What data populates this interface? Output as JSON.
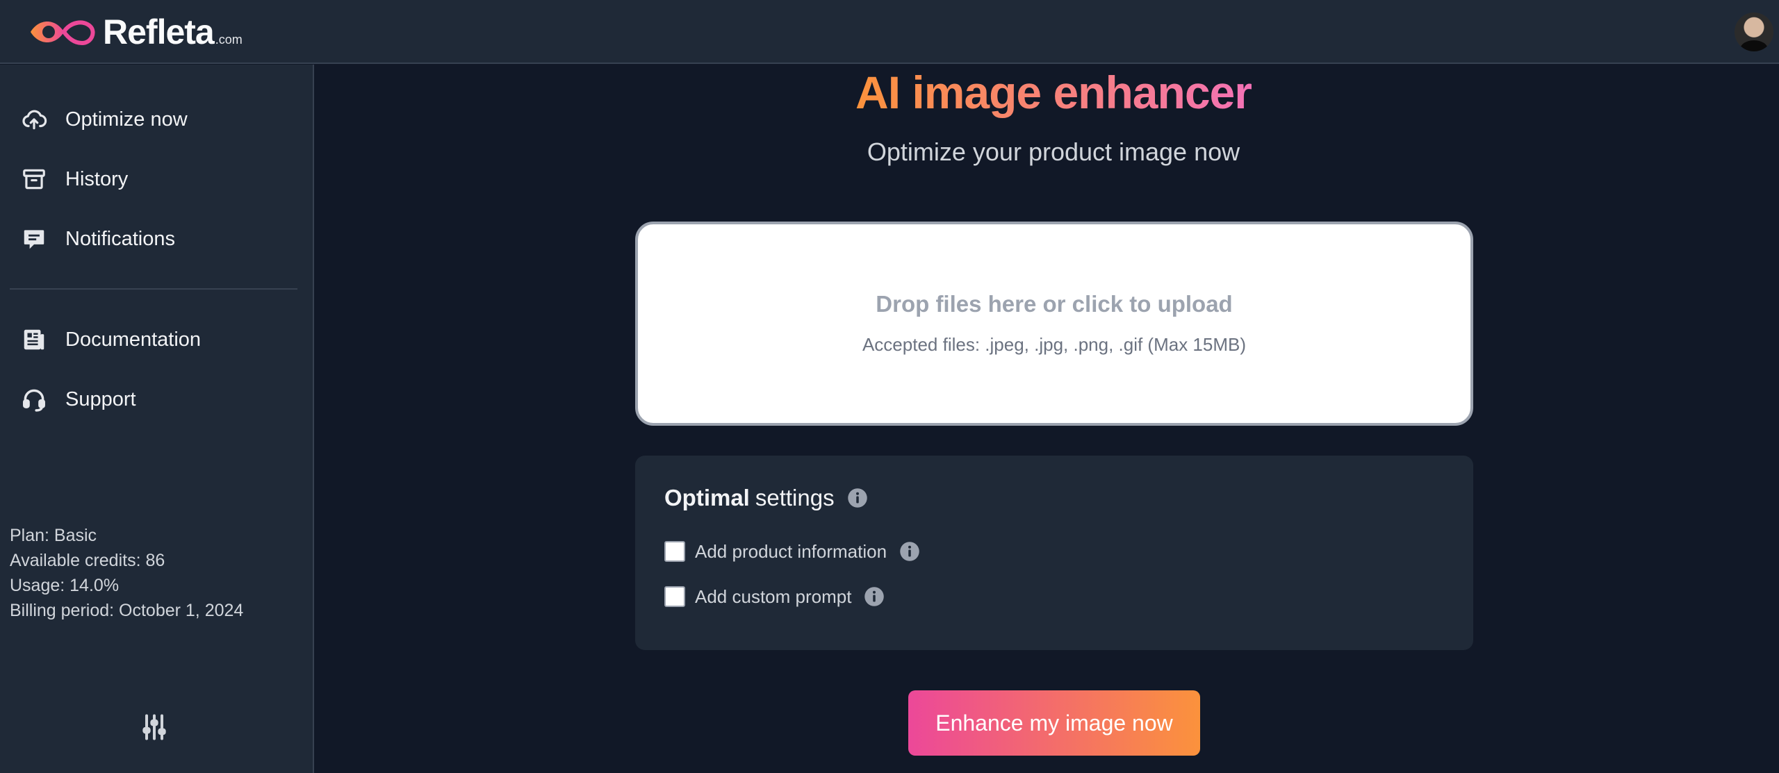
{
  "brand": {
    "name": "Refleta",
    "suffix": ".com"
  },
  "sidebar": {
    "items": [
      {
        "label": "Optimize now",
        "icon": "cloud-upload-icon"
      },
      {
        "label": "History",
        "icon": "archive-icon"
      },
      {
        "label": "Notifications",
        "icon": "message-icon"
      },
      {
        "label": "Documentation",
        "icon": "document-icon"
      },
      {
        "label": "Support",
        "icon": "headset-icon"
      }
    ],
    "plan": "Plan: Basic",
    "credits": "Available credits: 86",
    "usage": "Usage: 14.0%",
    "billing": "Billing period: October 1, 2024"
  },
  "main": {
    "title": "AI image enhancer",
    "subtitle": "Optimize your product image now",
    "dropzone": {
      "title": "Drop files here or click to upload",
      "subtitle": "Accepted files: .jpeg, .jpg, .png, .gif (Max 15MB)"
    },
    "settings": {
      "title_bold": "Optimal",
      "title_rest": "settings",
      "options": [
        {
          "label": "Add product information",
          "checked": false
        },
        {
          "label": "Add custom prompt",
          "checked": false
        }
      ]
    },
    "cta_label": "Enhance my image now"
  },
  "colors": {
    "background": "#111827",
    "panel": "#1f2937",
    "accent_orange": "#fb923c",
    "accent_pink": "#ec4899"
  }
}
